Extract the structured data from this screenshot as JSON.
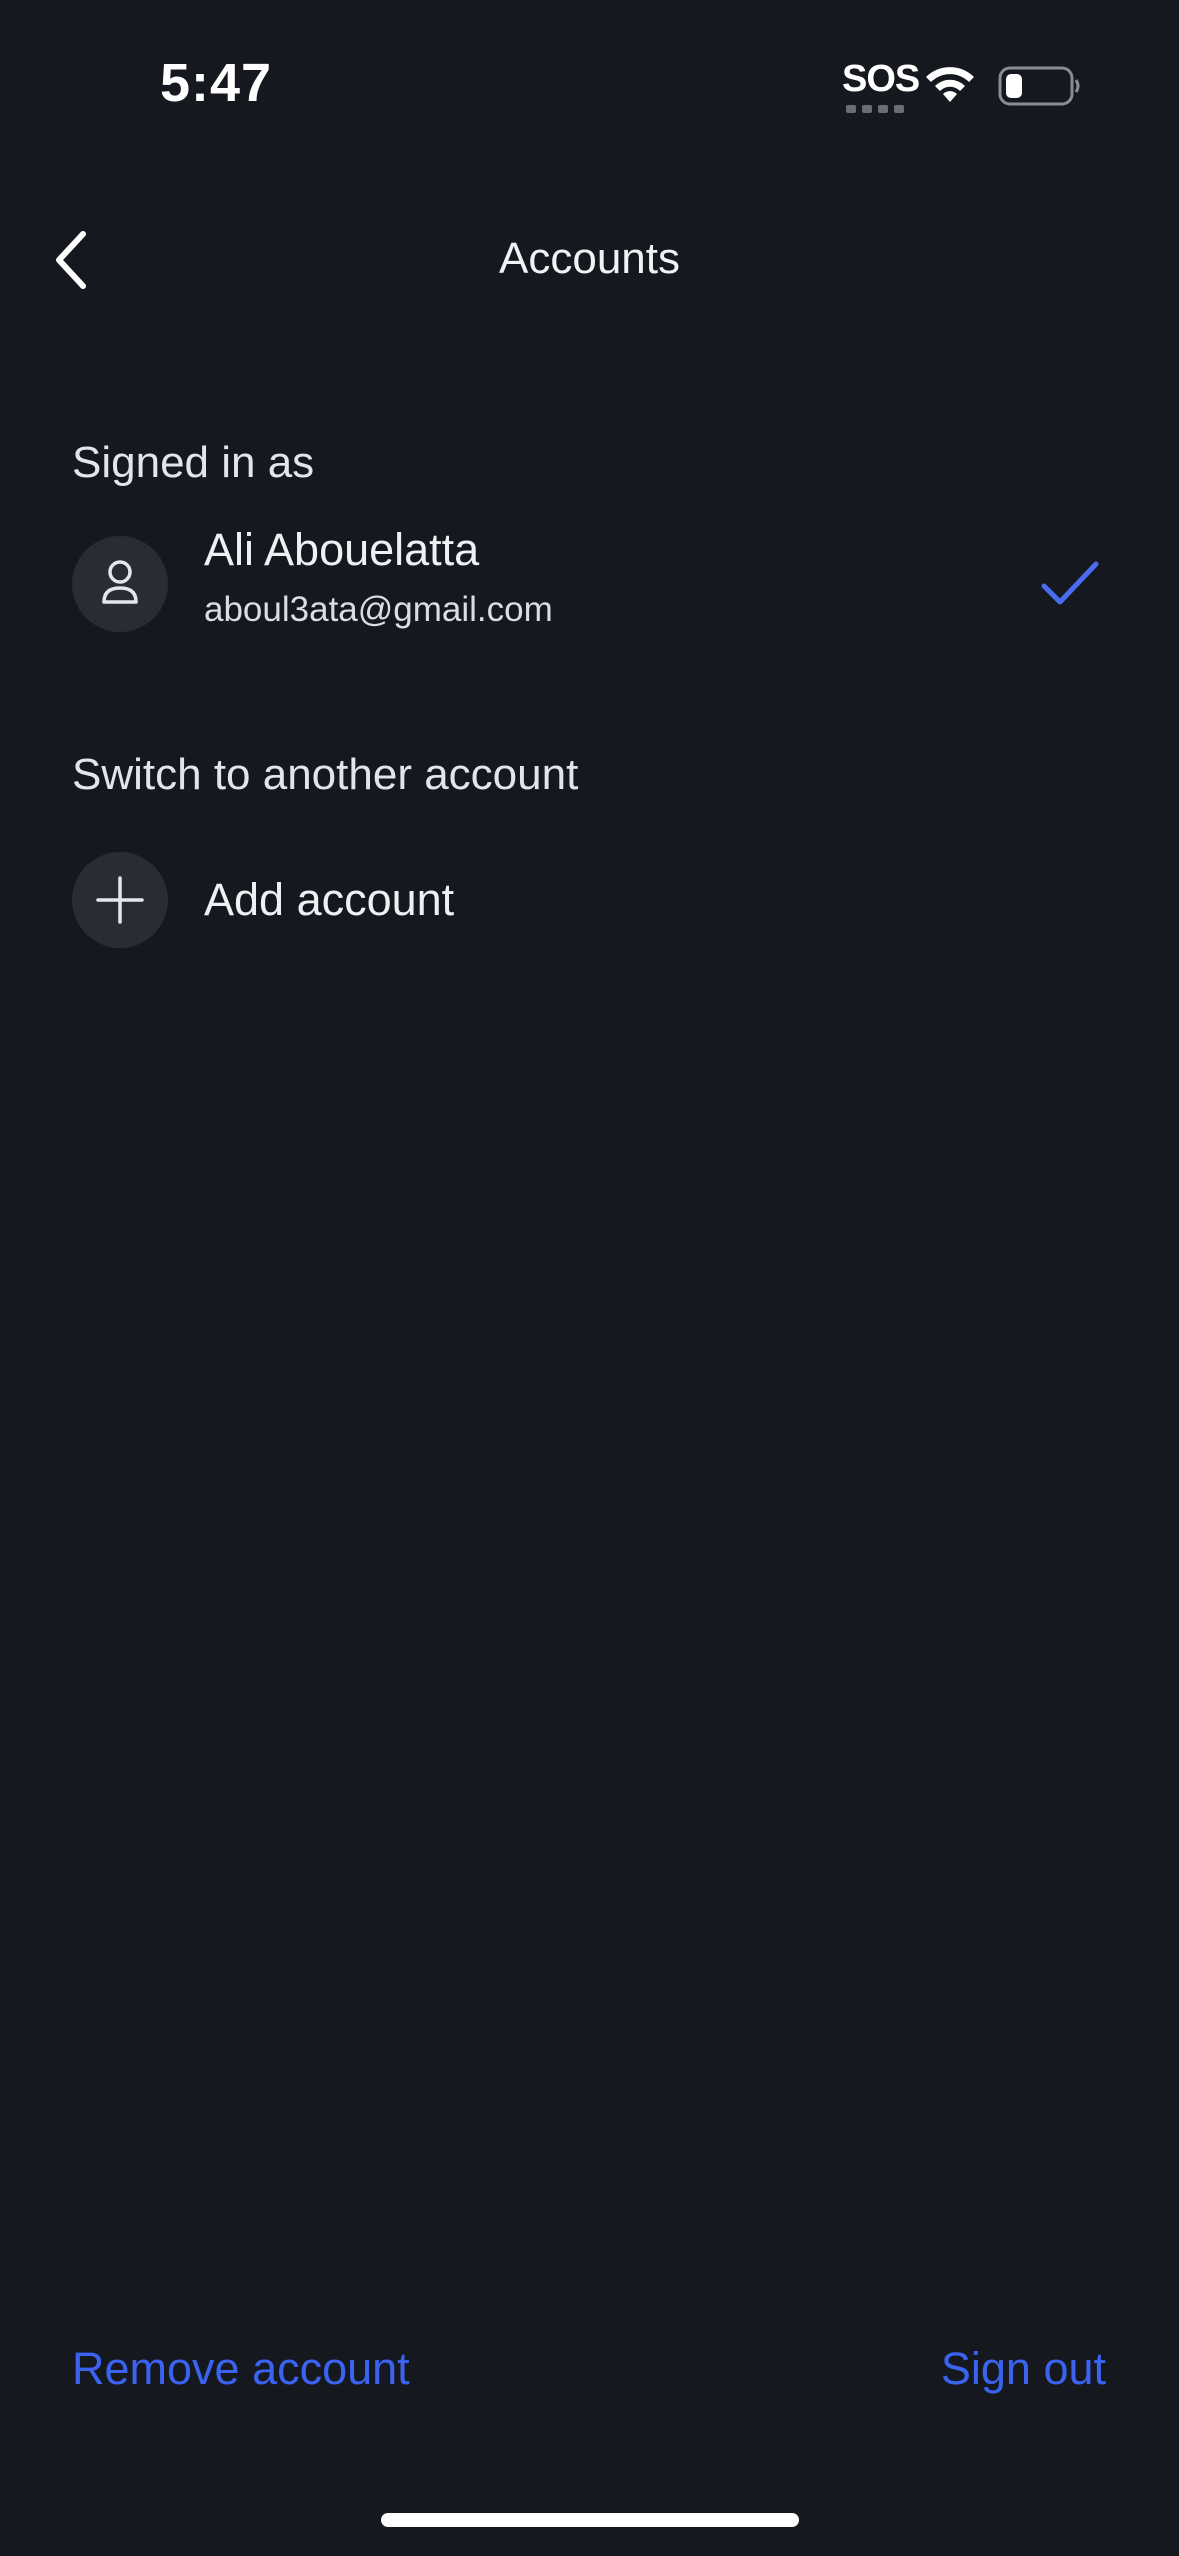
{
  "status_bar": {
    "time": "5:47",
    "sos": "SOS",
    "icons": [
      "wifi-icon",
      "battery-icon"
    ]
  },
  "header": {
    "title": "Accounts",
    "back_icon": "chevron-left-icon"
  },
  "signed_in": {
    "section_label": "Signed in as",
    "account": {
      "name": "Ali Abouelatta",
      "email": "aboul3ata@gmail.com",
      "avatar_icon": "person-icon",
      "selected_icon": "checkmark-icon"
    }
  },
  "switch": {
    "section_label": "Switch to another account",
    "add_label": "Add account",
    "add_icon": "plus-icon"
  },
  "footer": {
    "remove_label": "Remove account",
    "sign_out_label": "Sign out"
  },
  "colors": {
    "background": "#161820",
    "accent": "#3a63f0",
    "check": "#4a6cf0",
    "avatar_bg": "#2a2c33"
  }
}
